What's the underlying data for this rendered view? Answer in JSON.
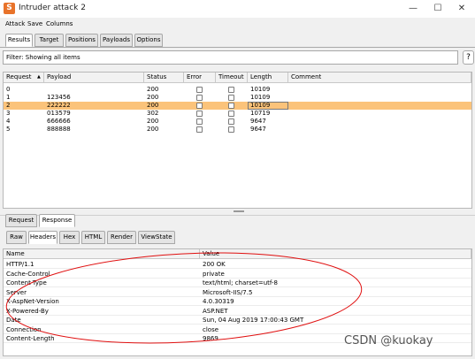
{
  "window": {
    "title": "Intruder attack 2",
    "icon_glyph": "S",
    "controls": {
      "minimize": "—",
      "maximize": "☐",
      "close": "✕"
    }
  },
  "menu": [
    "Attack",
    "Save",
    "Columns"
  ],
  "main_tabs": [
    "Results",
    "Target",
    "Positions",
    "Payloads",
    "Options"
  ],
  "filter": {
    "text": "Filter: Showing all items",
    "help": "?"
  },
  "results": {
    "columns": [
      "Request",
      "Payload",
      "Status",
      "Error",
      "Timeout",
      "Length",
      "Comment"
    ],
    "sort_indicator": "▲",
    "rows": [
      {
        "request": "0",
        "payload": "",
        "status": "200",
        "length": "10109",
        "selected": false
      },
      {
        "request": "1",
        "payload": "123456",
        "status": "200",
        "length": "10109",
        "selected": false
      },
      {
        "request": "2",
        "payload": "222222",
        "status": "200",
        "length": "10109",
        "selected": true
      },
      {
        "request": "3",
        "payload": "013579",
        "status": "302",
        "length": "10719",
        "selected": false
      },
      {
        "request": "4",
        "payload": "666666",
        "status": "200",
        "length": "9647",
        "selected": false
      },
      {
        "request": "5",
        "payload": "888888",
        "status": "200",
        "length": "9647",
        "selected": false
      }
    ]
  },
  "detail_tabs": [
    "Request",
    "Response"
  ],
  "view_tabs": [
    "Raw",
    "Headers",
    "Hex",
    "HTML",
    "Render",
    "ViewState"
  ],
  "headers": {
    "columns": [
      "Name",
      "Value"
    ],
    "rows": [
      {
        "name": "HTTP/1.1",
        "value": "200 OK"
      },
      {
        "name": "Cache-Control",
        "value": "private"
      },
      {
        "name": "Content-Type",
        "value": "text/html; charset=utf-8"
      },
      {
        "name": "Server",
        "value": "Microsoft-IIS/7.5"
      },
      {
        "name": "X-AspNet-Version",
        "value": "4.0.30319"
      },
      {
        "name": "X-Powered-By",
        "value": "ASP.NET"
      },
      {
        "name": "Date",
        "value": "Sun, 04 Aug 2019 17:00:43 GMT"
      },
      {
        "name": "Connection",
        "value": "close"
      },
      {
        "name": "Content-Length",
        "value": "9869"
      }
    ]
  },
  "watermark": "CSDN @kuokay",
  "colors": {
    "selected_row": "#fbc37a",
    "annotation": "#e01010",
    "app_icon": "#e8732a"
  }
}
